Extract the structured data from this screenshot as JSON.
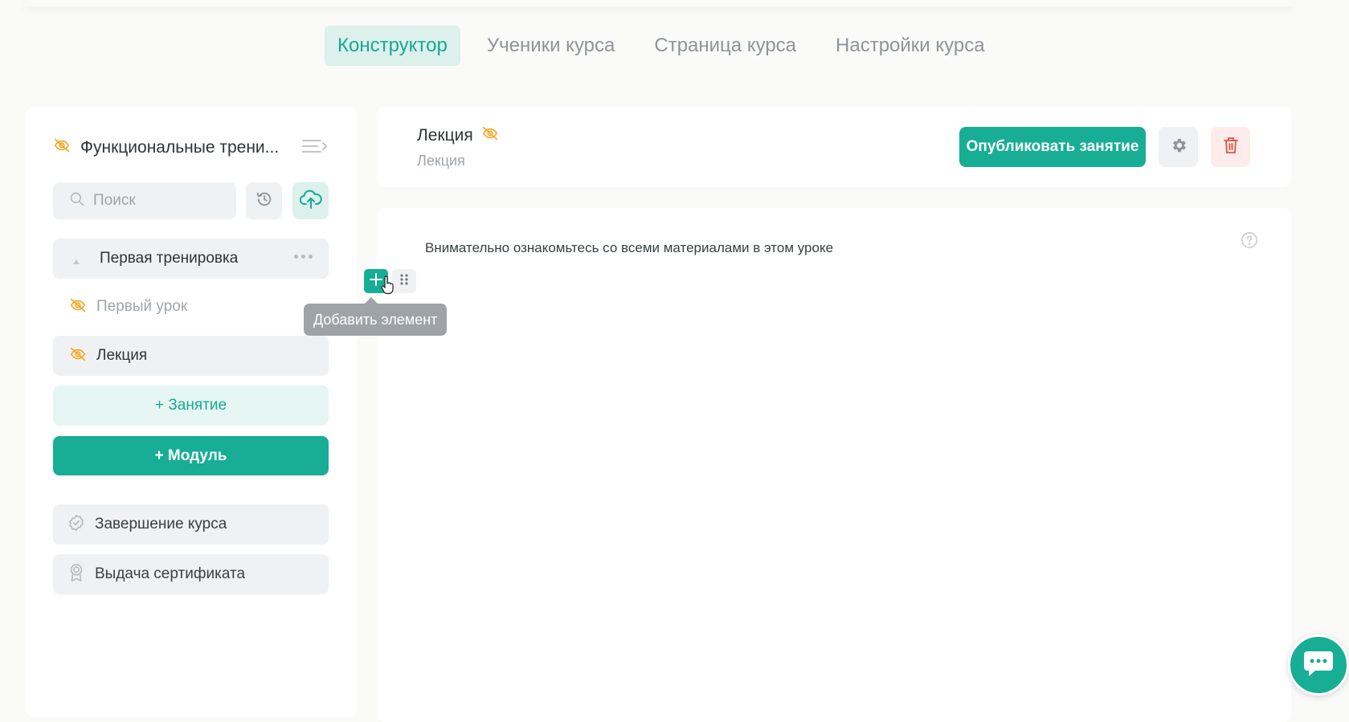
{
  "tabs": [
    {
      "label": "Конструктор",
      "active": true
    },
    {
      "label": "Ученики курса",
      "active": false
    },
    {
      "label": "Страница курса",
      "active": false
    },
    {
      "label": "Настройки курса",
      "active": false
    }
  ],
  "sidebar": {
    "course_title": "Функциональные трени...",
    "search_placeholder": "Поиск",
    "module": {
      "label": "Первая тренировка"
    },
    "lessons": [
      {
        "label": "Первый урок",
        "hidden": true
      },
      {
        "label": "Лекция",
        "hidden": true,
        "selected": true
      }
    ],
    "add_lesson_label": "+ Занятие",
    "add_module_label": "+ Модуль",
    "finish_label": "Завершение курса",
    "certificate_label": "Выдача сертификата"
  },
  "header": {
    "title": "Лекция",
    "subtitle": "Лекция",
    "publish_label": "Опубликовать занятие"
  },
  "content": {
    "text": "Внимательно ознакомьтесь со всеми материалами в этом уроке",
    "tooltip": "Добавить элемент"
  },
  "colors": {
    "accent": "#17ae95",
    "accent_light": "#dcf0ec",
    "hidden_icon": "#f5a623",
    "danger": "#e0533f"
  },
  "icons": {
    "hidden": "eye-slash-icon",
    "menu": "collapse-menu-icon",
    "search": "search-icon",
    "history": "history-icon",
    "upload": "cloud-upload-icon",
    "settings": "gear-icon",
    "delete": "trash-icon",
    "help": "question-icon",
    "add": "plus-icon",
    "drag": "drag-handle-icon",
    "chat": "chat-icon"
  }
}
